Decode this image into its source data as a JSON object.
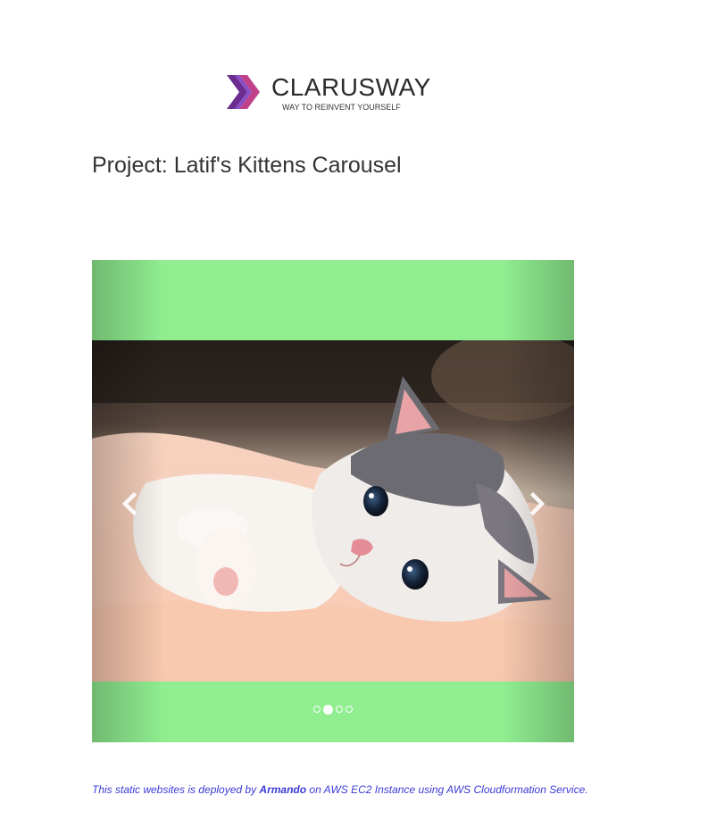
{
  "logo": {
    "name": "CLARUSWAY",
    "tagline": "WAY TO REINVENT YOURSELF",
    "icon": "clarusway-chevron-logo",
    "colors": {
      "purple": "#6b2d8f",
      "magenta": "#c0408a",
      "violet": "#8a4fc6"
    }
  },
  "page": {
    "title": "Project: Latif's Kittens Carousel"
  },
  "carousel": {
    "background_color": "#90ee90",
    "image_subject": "kitten-photo",
    "prev_icon": "chevron-left-icon",
    "next_icon": "chevron-right-icon",
    "slide_count": 4,
    "active_index": 1
  },
  "footer": {
    "prefix": "This static websites is deployed by ",
    "author": "Armando",
    "suffix": " on AWS EC2 Instance using AWS Cloudformation Service.",
    "color": "#3b3bd6"
  }
}
